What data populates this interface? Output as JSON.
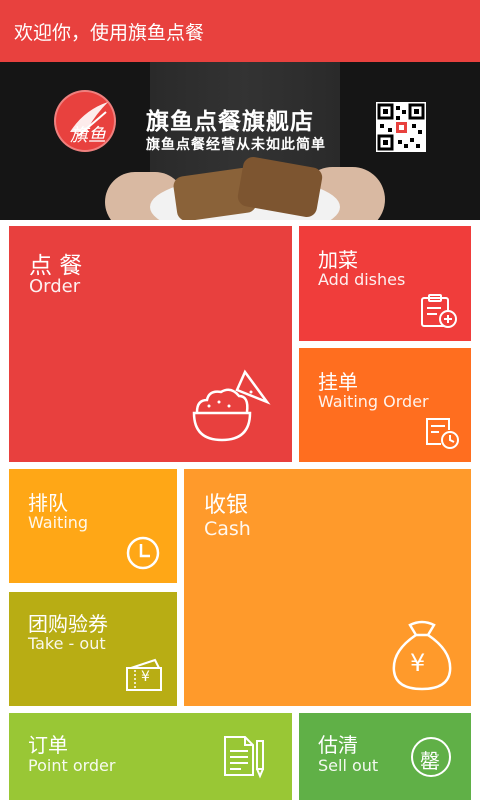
{
  "header": {
    "title": "欢迎你，使用旗鱼点餐"
  },
  "banner": {
    "logo_text": "旗鱼",
    "shop_name": "旗鱼点餐旗舰店",
    "slogan": "旗鱼点餐经营从未如此简单"
  },
  "tiles": {
    "order": {
      "zh": "点 餐",
      "en": "Order",
      "color": "#e8403e",
      "icon": "rice-bowl-icon"
    },
    "add_dishes": {
      "zh": "加菜",
      "en": "Add dishes",
      "color": "#f03d3b",
      "icon": "clipboard-plus-icon"
    },
    "waiting_order": {
      "zh": "挂单",
      "en": "Waiting Order",
      "color": "#ff6e1f",
      "icon": "pending-list-icon"
    },
    "queue": {
      "zh": "排队",
      "en": "Waiting",
      "color": "#ffa716",
      "icon": "clock-icon"
    },
    "cash": {
      "zh": "收银",
      "en": "Cash",
      "color": "#ff9a2b",
      "icon": "money-bag-icon",
      "icon_symbol": "¥"
    },
    "group_buy": {
      "zh": "团购验券",
      "en": "Take - out",
      "color": "#b8ad14",
      "icon": "voucher-icon",
      "icon_symbol": "¥"
    },
    "point_order": {
      "zh": "订单",
      "en": "Point order",
      "color": "#99c735",
      "icon": "document-pen-icon"
    },
    "sell_out": {
      "zh": "估清",
      "en": "Sell out",
      "color": "#60b047",
      "icon": "sold-out-stamp-icon",
      "icon_symbol": "罄"
    }
  }
}
